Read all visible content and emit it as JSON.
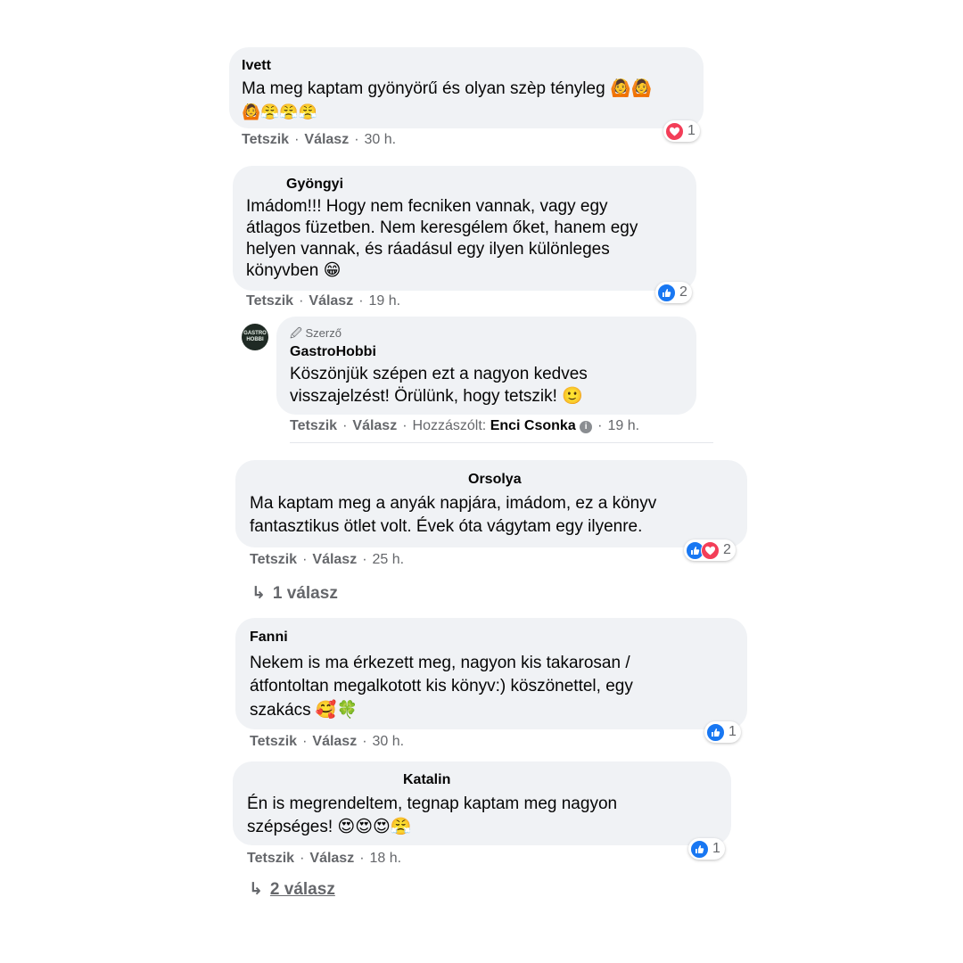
{
  "comments": [
    {
      "author": "Ivett",
      "lines": [
        "Ma meg kaptam gyönyörű és olyan szèp tényleg 🙆🙆",
        "🙆😤😤😤"
      ],
      "actions": {
        "like": "Tetszik",
        "reply": "Válasz",
        "time": "30 h."
      },
      "reaction": {
        "icons": [
          "love-icon"
        ],
        "count": "1"
      }
    },
    {
      "author": "Gyöngyi",
      "lines": [
        "Imádom!!! Hogy nem fecniken vannak, vagy egy",
        "átlagos füzetben. Nem keresgélem őket, hanem egy",
        "helyen vannak, és ráadásul egy ilyen különleges",
        "könyvben 😁"
      ],
      "actions": {
        "like": "Tetszik",
        "reply": "Válasz",
        "time": "19 h."
      },
      "reaction": {
        "icons": [
          "like-icon"
        ],
        "count": "2"
      },
      "reply": {
        "badge": "🖉 Szerző",
        "avatar_text": "GASTRO HOBBI",
        "author": "GastroHobbi",
        "lines": [
          "Köszönjük szépen ezt a nagyon kedves",
          "visszajelzést! Örülünk, hogy tetszik! 🙂"
        ],
        "actions": {
          "like": "Tetszik",
          "reply": "Válasz",
          "contributed_label": "Hozzászólt:",
          "contributor": "Enci Csonka",
          "time": "19 h."
        }
      }
    },
    {
      "author": "Orsolya",
      "lines": [
        "Ma kaptam meg a anyák napjára, imádom, ez a könyv",
        "fantasztikus ötlet volt. Évek óta vágytam egy ilyenre."
      ],
      "actions": {
        "like": "Tetszik",
        "reply": "Válasz",
        "time": "25 h."
      },
      "reaction": {
        "icons": [
          "like-icon",
          "love-icon"
        ],
        "count": "2"
      },
      "replies_link": "1 válasz"
    },
    {
      "author": "Fanni",
      "lines": [
        "Nekem is ma érkezett meg, nagyon kis takarosan /",
        "átfontoltan megalkotott kis könyv:) köszönettel, egy",
        "szakács 🥰🍀"
      ],
      "actions": {
        "like": "Tetszik",
        "reply": "Válasz",
        "time": "30 h."
      },
      "reaction": {
        "icons": [
          "like-icon"
        ],
        "count": "1"
      }
    },
    {
      "author": "Katalin",
      "lines": [
        "Én is megrendeltem, tegnap kaptam meg nagyon",
        "szépséges! 😍😍😍😤"
      ],
      "actions": {
        "like": "Tetszik",
        "reply": "Válasz",
        "time": "18 h."
      },
      "reaction": {
        "icons": [
          "like-icon"
        ],
        "count": "1"
      },
      "replies_link": "2 válasz"
    }
  ],
  "colors": {
    "bubble": "#f0f2f5",
    "like": "#1877f2",
    "love": "#f33e58",
    "meta": "#65676b"
  }
}
